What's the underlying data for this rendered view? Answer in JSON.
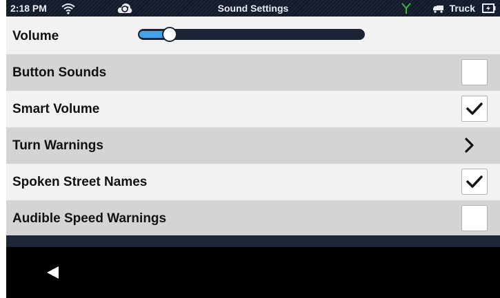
{
  "status_bar": {
    "time": "2:18 PM",
    "title": "Sound Settings",
    "carrier": "Truck",
    "icons": [
      "wifi-icon",
      "cloud-sync-icon",
      "antenna-icon",
      "truck-icon",
      "battery-icon"
    ]
  },
  "volume": {
    "label": "Volume",
    "level": 0.14
  },
  "settings": [
    {
      "label": "Button Sounds",
      "control": "checkbox",
      "checked": false
    },
    {
      "label": "Smart Volume",
      "control": "checkbox",
      "checked": true
    },
    {
      "label": "Turn Warnings",
      "control": "chevron"
    },
    {
      "label": "Spoken Street Names",
      "control": "checkbox",
      "checked": true
    },
    {
      "label": "Audible Speed Warnings",
      "control": "checkbox",
      "checked": false
    }
  ],
  "colors": {
    "status_bar_bg": "#1c2536",
    "row_light": "#f2f2f2",
    "row_dark": "#d4d4d4",
    "slider_fill": "#43a3e9",
    "slider_track": "#1b2436",
    "antenna": "#3cb83c"
  },
  "nav": {
    "back_icon": "back-triangle-icon"
  }
}
